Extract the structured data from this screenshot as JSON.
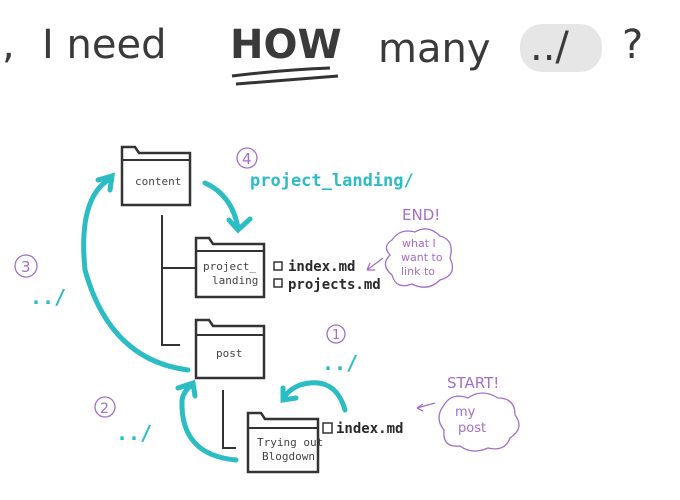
{
  "title": {
    "prefix": ",",
    "text_1": "I need",
    "emphasis": "HOW",
    "text_2": "many",
    "highlight": "../",
    "suffix": "?"
  },
  "folders": {
    "content": "content",
    "project_landing": [
      "project_",
      "landing"
    ],
    "post": "post",
    "blogdown": [
      "Trying out",
      "Blogdown"
    ]
  },
  "files": {
    "project_landing": [
      "index.md",
      "projects.md"
    ],
    "blogdown": [
      "index.md"
    ]
  },
  "steps": [
    {
      "number": "1",
      "label": "../"
    },
    {
      "number": "2",
      "label": "../"
    },
    {
      "number": "3",
      "label": "../"
    },
    {
      "number": "4",
      "label": "project_landing/"
    }
  ],
  "notes": {
    "end_label": "END!",
    "end_cloud": [
      "what I",
      "want to",
      "link to"
    ],
    "start_label": "START!",
    "start_cloud": [
      "my",
      "post"
    ]
  },
  "colors": {
    "teal": "#2bbcc4",
    "purple": "#a36fc9",
    "ink": "#333333"
  }
}
